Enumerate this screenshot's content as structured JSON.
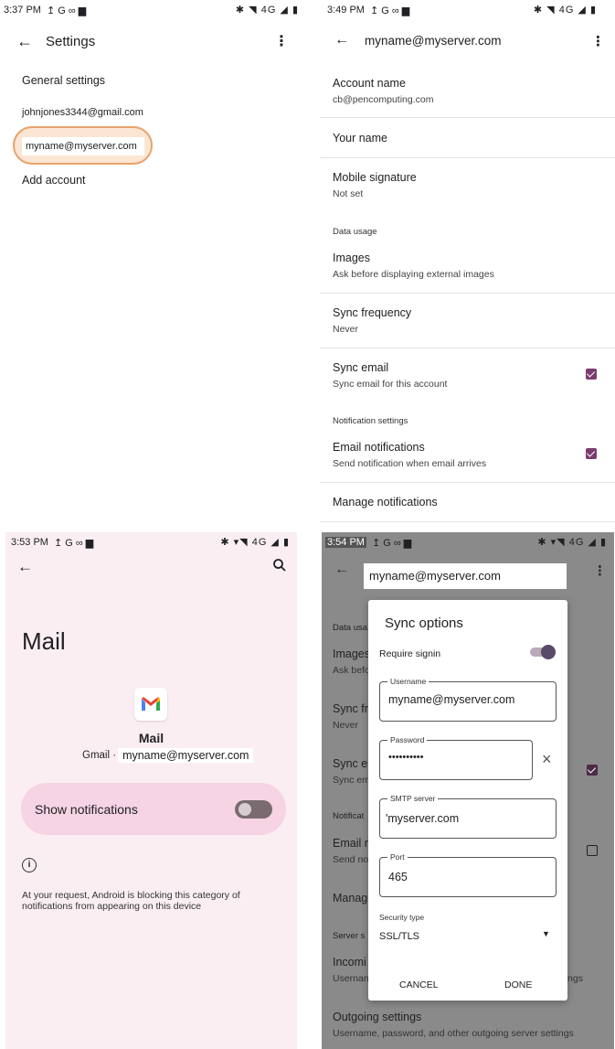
{
  "panel1": {
    "status": {
      "time": "3:37 PM",
      "icons_left": "↥ G ∞ ▆",
      "icons_right": "✱ ◥ 4G ◢ ▮"
    },
    "title": "Settings",
    "items": {
      "general": "General settings",
      "account1": "johnjones3344@gmail.com",
      "account2": "myname@myserver.com",
      "add": "Add account"
    }
  },
  "panel2": {
    "status": {
      "time": "3:49 PM",
      "icons_left": "↥ G ∞ ▆",
      "icons_right": "✱ ◥ 4G ◢ ▮"
    },
    "title": "myname@myserver.com",
    "account_name_title": "Account name",
    "account_name_value": "cb@pencomputing.com",
    "your_name": "Your name",
    "mobile_signature_title": "Mobile signature",
    "mobile_signature_value": "Not set",
    "data_usage_header": "Data usage",
    "images_title": "Images",
    "images_value": "Ask before displaying external images",
    "sync_freq_title": "Sync frequency",
    "sync_freq_value": "Never",
    "sync_email_title": "Sync email",
    "sync_email_value": "Sync email for this account",
    "notif_header": "Notification settings",
    "email_notif_title": "Email notifications",
    "email_notif_value": "Send notification when email arrives",
    "manage_notif": "Manage notifications"
  },
  "panel3": {
    "status": {
      "time": "3:53 PM",
      "icons_left": "↥ G ∞ ▆",
      "icons_right": "✱ ▾◥ 4G ◢ ▮"
    },
    "big_title": "Mail",
    "app_name": "Mail",
    "gmail_label": "Gmail ·",
    "account": "myname@myserver.com",
    "show_notifications": "Show notifications",
    "info_text": "At your request, Android is blocking this category of notifications from appearing on this device"
  },
  "panel4": {
    "status": {
      "time": "3:54 PM",
      "icons_left": "↥ G ∞ ▆",
      "icons_right": "✱ ▾◥ 4G ◢ ▮"
    },
    "title": "myname@myserver.com",
    "bg": {
      "data_usage": "Data usa",
      "images": "Images",
      "images_sub": "Ask befo",
      "sync_freq": "Sync fr",
      "sync_freq_sub": "Never",
      "sync_email": "Sync e",
      "sync_email_sub": "Sync em",
      "notif_header": "Notificat",
      "email_notif": "Email n",
      "email_notif_sub": "Send no",
      "manage": "Manag",
      "server": "Server s",
      "incoming": "Incomi",
      "incoming_sub": "Usernan",
      "incoming_sub_right": "ngs",
      "outgoing": "Outgoing settings",
      "outgoing_sub": "Username, password, and other outgoing server settings"
    },
    "dialog": {
      "title": "Sync options",
      "require_signin": "Require signin",
      "username_label": "Username",
      "username_value": "myname@myserver.com",
      "password_label": "Password",
      "password_value": "••••••••••",
      "smtp_label": "SMTP server",
      "smtp_value": "'myserver.com",
      "port_label": "Port",
      "port_value": "465",
      "security_label": "Security type",
      "security_value": "SSL/TLS",
      "cancel": "CANCEL",
      "done": "DONE"
    }
  },
  "colors": {
    "accent": "#7b3c6e",
    "highlight": "#e8a36b",
    "pink_bg": "#fbeef3",
    "pink_card": "#f6d4e3"
  }
}
